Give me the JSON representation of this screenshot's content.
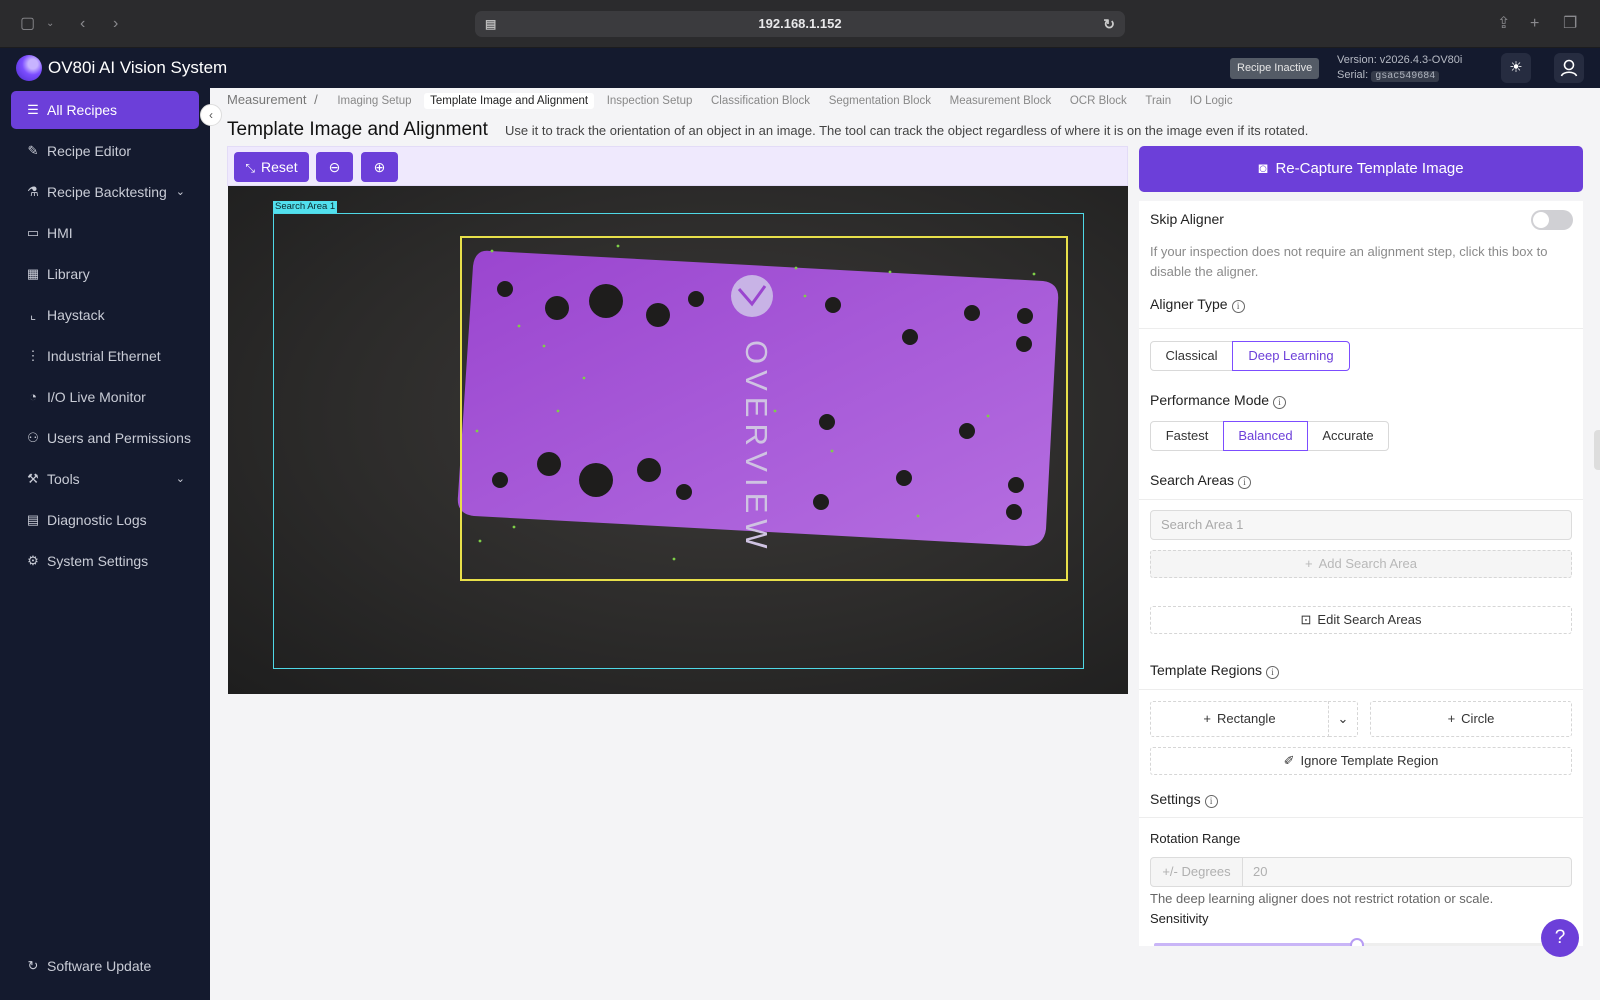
{
  "browser": {
    "url": "192.168.1.152"
  },
  "header": {
    "app_title": "OV80i AI Vision System",
    "recipe_status": "Recipe Inactive",
    "version_label": "Version: v2026.4.3-OV80i",
    "serial_label": "Serial:",
    "serial_value": "gsac549684"
  },
  "sidebar": {
    "items": [
      {
        "label": "All Recipes",
        "icon": "list-icon",
        "active": true
      },
      {
        "label": "Recipe Editor",
        "icon": "pencil-icon"
      },
      {
        "label": "Recipe Backtesting",
        "icon": "flask-icon",
        "expandable": true
      },
      {
        "label": "HMI",
        "icon": "display-icon"
      },
      {
        "label": "Library",
        "icon": "grid-icon"
      },
      {
        "label": "Haystack",
        "icon": "chart-icon"
      },
      {
        "label": "Industrial Ethernet",
        "icon": "network-icon"
      },
      {
        "label": "I/O Live Monitor",
        "icon": "monitor-icon"
      },
      {
        "label": "Users and Permissions",
        "icon": "user-icon"
      },
      {
        "label": "Tools",
        "icon": "wrench-icon",
        "expandable": true
      },
      {
        "label": "Diagnostic Logs",
        "icon": "file-icon"
      },
      {
        "label": "System Settings",
        "icon": "gear-icon"
      }
    ],
    "footer": {
      "label": "Software Update",
      "icon": "refresh-icon"
    }
  },
  "breadcrumb": {
    "root": "Measurement",
    "separator": "/",
    "tabs": [
      "Imaging Setup",
      "Template Image and Alignment",
      "Inspection Setup",
      "Classification Block",
      "Segmentation Block",
      "Measurement Block",
      "OCR Block",
      "Train",
      "IO Logic"
    ],
    "active_tab": "Template Image and Alignment"
  },
  "page": {
    "title": "Template Image and Alignment",
    "description": "Use it to track the orientation of an object in an image. The tool can track the object regardless of where it is on the image even if its rotated."
  },
  "viewer": {
    "reset_label": "Reset",
    "search_area_label": "Search Area 1",
    "plate_text": "OVERVIEW"
  },
  "panel": {
    "recapture_label": "Re-Capture Template Image",
    "skip_aligner": {
      "label": "Skip Aligner",
      "enabled": false,
      "help": "If your inspection does not require an alignment step, click this box to disable the aligner."
    },
    "aligner_type": {
      "label": "Aligner Type",
      "options": [
        "Classical",
        "Deep Learning"
      ],
      "selected": "Deep Learning"
    },
    "performance_mode": {
      "label": "Performance Mode",
      "options": [
        "Fastest",
        "Balanced",
        "Accurate"
      ],
      "selected": "Balanced"
    },
    "search_areas": {
      "label": "Search Areas",
      "placeholder": "Search Area 1",
      "add_label": "Add Search Area",
      "edit_label": "Edit Search Areas"
    },
    "template_regions": {
      "label": "Template Regions",
      "rectangle_label": "Rectangle",
      "circle_label": "Circle",
      "ignore_label": "Ignore Template Region"
    },
    "settings": {
      "label": "Settings",
      "rotation_range_label": "Rotation Range",
      "degrees_addon": "+/- Degrees",
      "degrees_value": "20",
      "rotation_help": "The deep learning aligner does not restrict rotation or scale.",
      "sensitivity_label": "Sensitivity",
      "sensitivity_level": 0.49
    }
  },
  "colors": {
    "accent": "#6c3fd9",
    "sidebar_bg": "#141a2e",
    "search_area": "#4fd8e6",
    "template_box": "#e8e04a",
    "plate": "#a74fd6"
  }
}
